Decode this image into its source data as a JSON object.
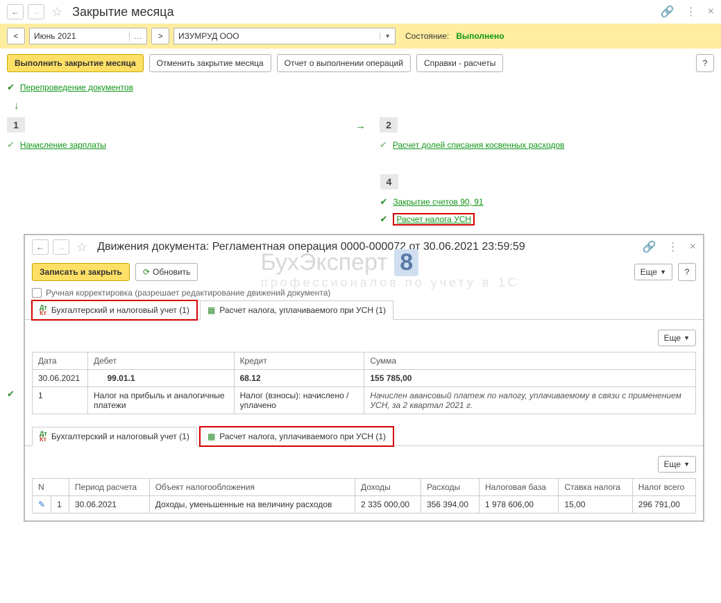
{
  "header": {
    "title": "Закрытие месяца"
  },
  "period": {
    "value": "Июнь 2021"
  },
  "org": {
    "value": "ИЗУМРУД ООО"
  },
  "state": {
    "label": "Состояние:",
    "value": "Выполнено"
  },
  "toolbar": {
    "execute": "Выполнить закрытие месяца",
    "cancel": "Отменить закрытие месяца",
    "report": "Отчет о выполнении операций",
    "refs": "Справки - расчеты",
    "help": "?"
  },
  "ops": {
    "repost": "Перепроведение документов",
    "salary": "Начисление зарплаты",
    "indirect": "Расчет долей списания косвенных расходов",
    "close9091": "Закрытие счетов 90, 91",
    "usn": "Расчет налога УСН"
  },
  "stages": {
    "s1": "1",
    "s2": "2",
    "s4": "4"
  },
  "sub": {
    "title": "Движения документа: Регламентная операция 0000-000072 от 30.06.2021 23:59:59",
    "save": "Записать и закрыть",
    "refresh": "Обновить",
    "more": "Еще",
    "help": "?",
    "manual": "Ручная корректировка (разрешает редактирование движений документа)",
    "tab1": "Бухгалтерский и налоговый учет (1)",
    "tab2": "Расчет налога, уплачиваемого при УСН (1)"
  },
  "table1": {
    "headers": {
      "date": "Дата",
      "debit": "Дебет",
      "credit": "Кредит",
      "sum": "Сумма"
    },
    "row": {
      "date": "30.06.2021",
      "n": "1",
      "debit_acc": "99.01.1",
      "debit_desc": "Налог на прибыль и аналогичные платежи",
      "credit_acc": "68.12",
      "credit_desc": "Налог (взносы): начислено / уплачено",
      "sum": "155 785,00",
      "note": "Начислен авансовый платеж по налогу, уплачиваемому в связи с применением УСН, за 2 квартал 2021 г."
    }
  },
  "table2": {
    "headers": {
      "n": "N",
      "period": "Период расчета",
      "obj": "Объект налогообложения",
      "income": "Доходы",
      "expense": "Расходы",
      "base": "Налоговая база",
      "rate": "Ставка налога",
      "total": "Налог всего"
    },
    "row": {
      "n": "1",
      "period": "30.06.2021",
      "obj": "Доходы, уменьшенные на величину расходов",
      "income": "2 335 000,00",
      "expense": "356 394,00",
      "base": "1 978 606,00",
      "rate": "15,00",
      "total": "296 791,00"
    }
  },
  "watermark": {
    "l1": "БухЭксперт",
    "badge": "8",
    "l2": "профессионалов по учету в 1С"
  }
}
